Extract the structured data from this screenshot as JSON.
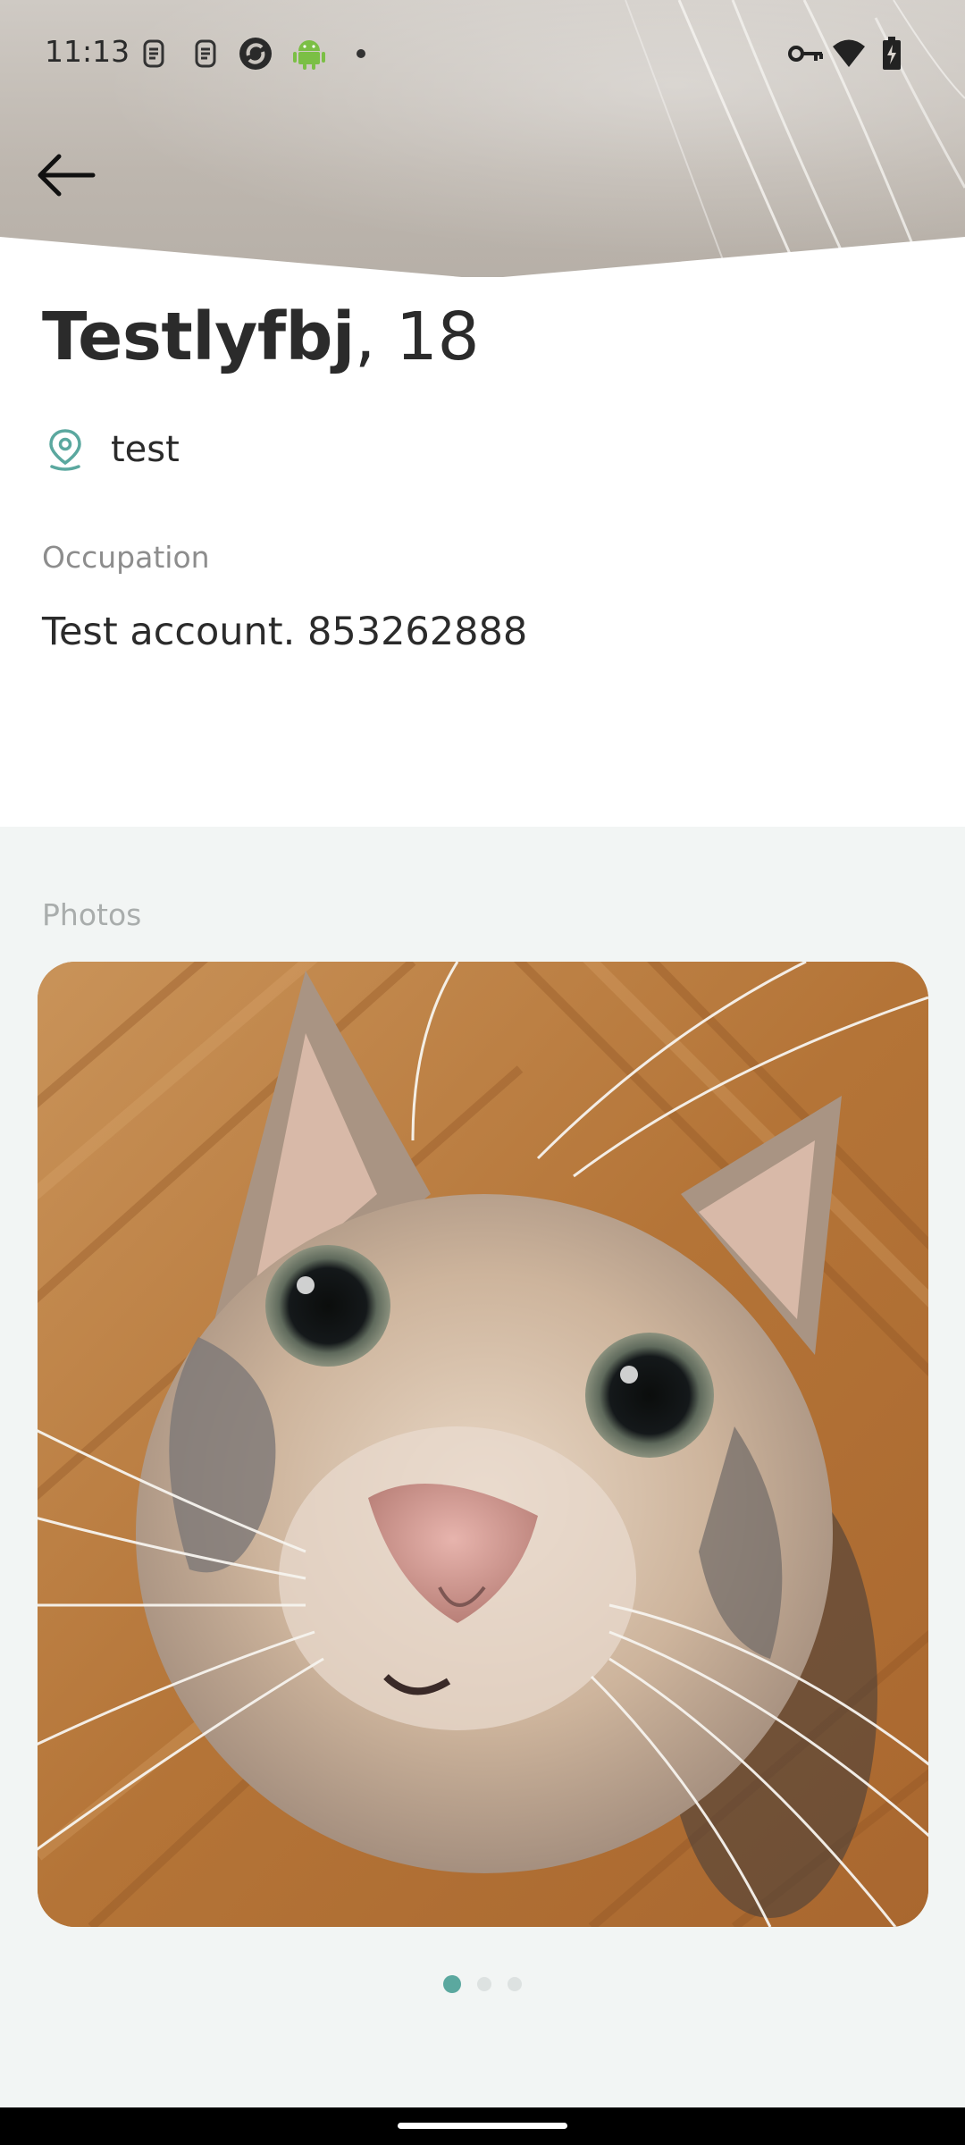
{
  "status_bar": {
    "time": "11:13",
    "left_icons": [
      "sim-icon",
      "sim-icon",
      "sync-icon",
      "android-icon",
      "dot-icon"
    ],
    "right_icons": [
      "vpn-key-icon",
      "wifi-icon",
      "battery-charging-icon"
    ]
  },
  "navigation": {
    "back_icon": "arrow-left-icon"
  },
  "profile": {
    "name": "Testlyfbj",
    "age": ", 18",
    "location": "test",
    "occupation_label": "Occupation",
    "occupation_value": "Test account. 853262888"
  },
  "photos": {
    "section_label": "Photos",
    "page_count": 3,
    "current_page": 1
  },
  "colors": {
    "accent": "#5ba89f",
    "text_primary": "#2b2b2b",
    "text_secondary": "#8d8d8d",
    "section_bg": "#f2f5f4"
  }
}
